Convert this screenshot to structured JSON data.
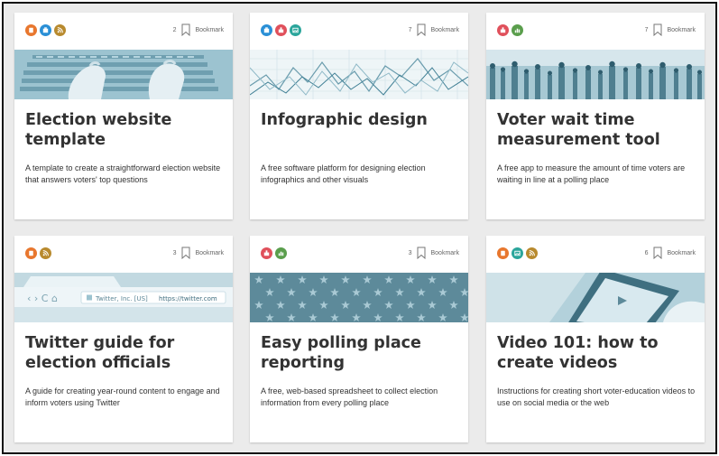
{
  "bookmark_label": "Bookmark",
  "colors": {
    "orange": "#e8772e",
    "blue": "#2a8fd6",
    "gold": "#b88a2e",
    "red": "#e0505b",
    "green": "#5a9e4c",
    "teal": "#2aa59b",
    "hero_tint": "#8fb9c7"
  },
  "cards": [
    {
      "title": "Election website template",
      "description": "A template to create a straightforward election website that answers voters' top questions",
      "bookmark_count": "2",
      "categories": [
        "document-icon",
        "building-icon",
        "feed-icon"
      ]
    },
    {
      "title": "Infographic design",
      "description": "A free software platform for designing election infographics and other visuals",
      "bookmark_count": "7",
      "categories": [
        "building-icon",
        "ballot-icon",
        "image-icon"
      ]
    },
    {
      "title": "Voter wait time measurement tool",
      "description": "A free app to measure the amount of time voters are waiting in line at a polling place",
      "bookmark_count": "7",
      "categories": [
        "ballot-icon",
        "chart-icon"
      ]
    },
    {
      "title": "Twitter guide for election officials",
      "description": "A guide for creating year-round content to engage and inform voters using Twitter",
      "bookmark_count": "3",
      "categories": [
        "document-icon",
        "feed-icon"
      ]
    },
    {
      "title": "Easy polling place reporting",
      "description": "A free, web-based spreadsheet to collect election information from every polling place",
      "bookmark_count": "3",
      "categories": [
        "ballot-icon",
        "chart-icon"
      ]
    },
    {
      "title": "Video 101: how to create videos",
      "description": "Instructions for creating short voter-education videos to use on social media or the web",
      "bookmark_count": "6",
      "categories": [
        "document-icon",
        "image-icon",
        "feed-icon"
      ]
    }
  ],
  "hero_text": {
    "browser_tab": "Twitter, Inc. [US]",
    "browser_url": "https://twitter.com"
  }
}
